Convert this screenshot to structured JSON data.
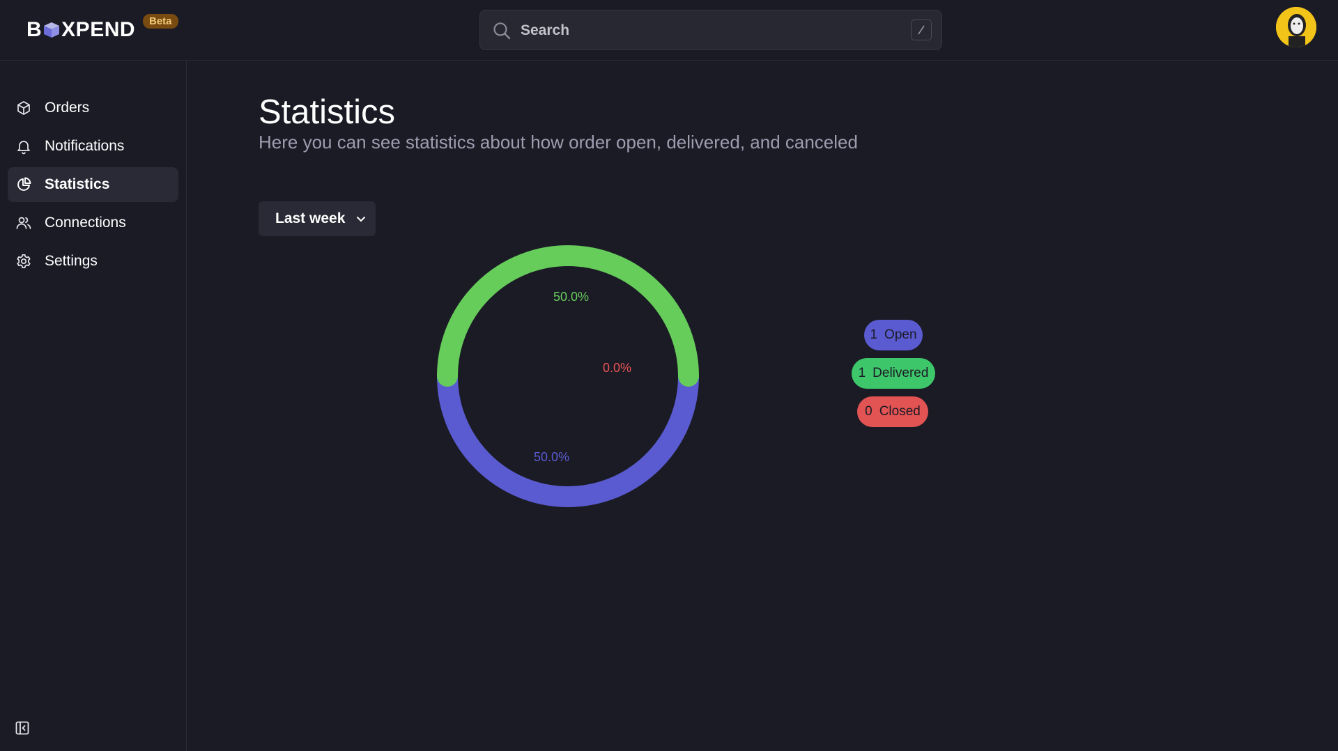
{
  "header": {
    "brand": {
      "left": "B",
      "right": "XPEND"
    },
    "badge": "Beta",
    "search_placeholder": "Search"
  },
  "sidebar": {
    "items": [
      {
        "label": "Orders",
        "icon": "box-icon",
        "active": false
      },
      {
        "label": "Notifications",
        "icon": "bell-icon",
        "active": false
      },
      {
        "label": "Statistics",
        "icon": "pie-chart-icon",
        "active": true
      },
      {
        "label": "Connections",
        "icon": "users-icon",
        "active": false
      },
      {
        "label": "Settings",
        "icon": "gear-icon",
        "active": false
      }
    ],
    "collapse_icon": "sidebar-collapse-icon"
  },
  "main": {
    "title": "Statistics",
    "subtitle": "Here you can see statistics about how order open, delivered, and canceled",
    "range_selected": "Last week"
  },
  "colors": {
    "open": "#5a5bd0",
    "delivered": "#66cc5a",
    "closed": "#e85454",
    "delivered_pill": "#3ec76a",
    "closed_pill": "#e25353"
  },
  "legend": [
    {
      "count": "1",
      "label": "Open"
    },
    {
      "count": "1",
      "label": "Delivered"
    },
    {
      "count": "0",
      "label": "Closed"
    }
  ],
  "chart_data": {
    "type": "pie",
    "variant": "donut",
    "categories": [
      "Open",
      "Delivered",
      "Closed"
    ],
    "values": [
      1,
      1,
      0
    ],
    "labels": [
      "50.0%",
      "50.0%",
      "0.0%"
    ]
  }
}
